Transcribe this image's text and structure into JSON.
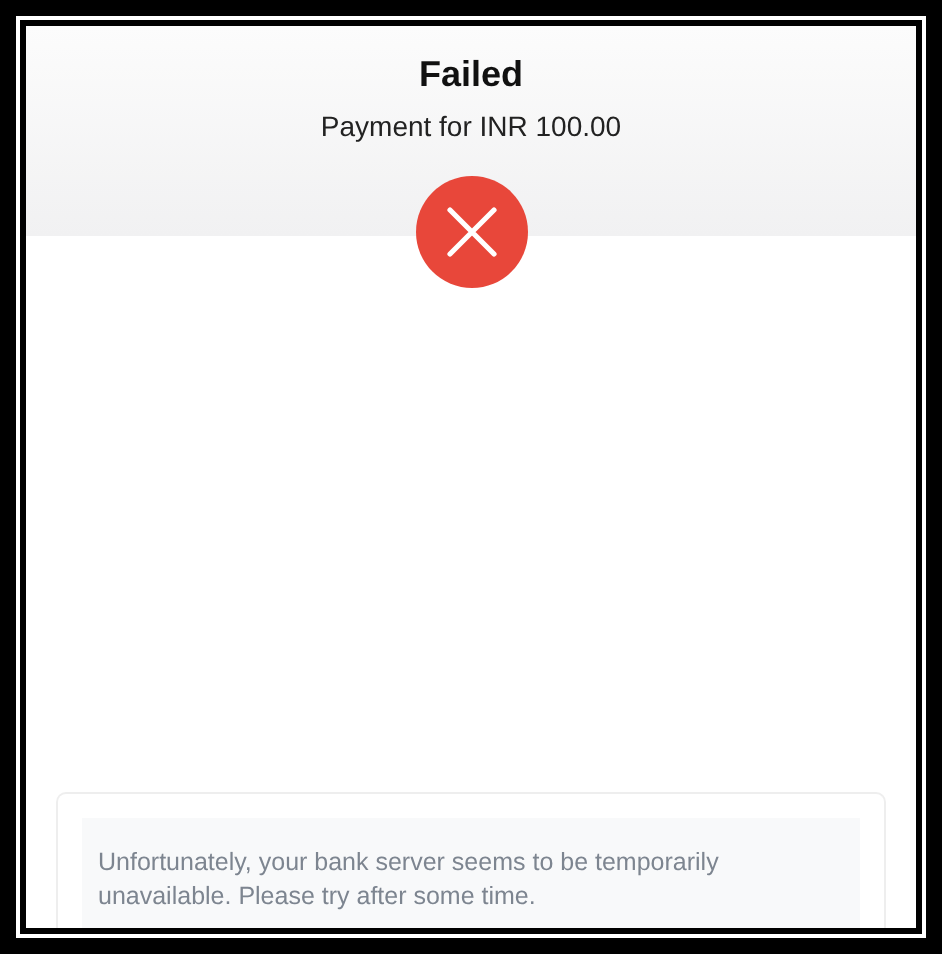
{
  "status": {
    "title": "Failed",
    "subtitle": "Payment for INR 100.00",
    "failed": true
  },
  "message": {
    "text": "Unfortunately, your bank server seems to be temporarily unavailable. Please try after some time."
  }
}
